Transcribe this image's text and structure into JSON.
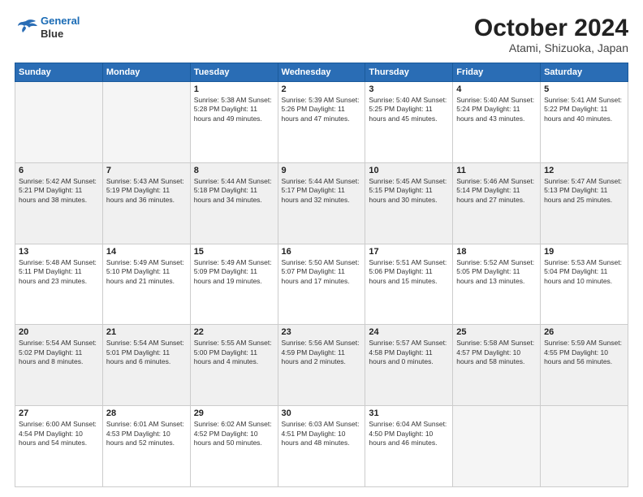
{
  "header": {
    "logo_line1": "General",
    "logo_line2": "Blue",
    "title": "October 2024",
    "subtitle": "Atami, Shizuoka, Japan"
  },
  "weekdays": [
    "Sunday",
    "Monday",
    "Tuesday",
    "Wednesday",
    "Thursday",
    "Friday",
    "Saturday"
  ],
  "weeks": [
    [
      {
        "day": "",
        "info": ""
      },
      {
        "day": "",
        "info": ""
      },
      {
        "day": "1",
        "info": "Sunrise: 5:38 AM\nSunset: 5:28 PM\nDaylight: 11 hours and 49 minutes."
      },
      {
        "day": "2",
        "info": "Sunrise: 5:39 AM\nSunset: 5:26 PM\nDaylight: 11 hours and 47 minutes."
      },
      {
        "day": "3",
        "info": "Sunrise: 5:40 AM\nSunset: 5:25 PM\nDaylight: 11 hours and 45 minutes."
      },
      {
        "day": "4",
        "info": "Sunrise: 5:40 AM\nSunset: 5:24 PM\nDaylight: 11 hours and 43 minutes."
      },
      {
        "day": "5",
        "info": "Sunrise: 5:41 AM\nSunset: 5:22 PM\nDaylight: 11 hours and 40 minutes."
      }
    ],
    [
      {
        "day": "6",
        "info": "Sunrise: 5:42 AM\nSunset: 5:21 PM\nDaylight: 11 hours and 38 minutes."
      },
      {
        "day": "7",
        "info": "Sunrise: 5:43 AM\nSunset: 5:19 PM\nDaylight: 11 hours and 36 minutes."
      },
      {
        "day": "8",
        "info": "Sunrise: 5:44 AM\nSunset: 5:18 PM\nDaylight: 11 hours and 34 minutes."
      },
      {
        "day": "9",
        "info": "Sunrise: 5:44 AM\nSunset: 5:17 PM\nDaylight: 11 hours and 32 minutes."
      },
      {
        "day": "10",
        "info": "Sunrise: 5:45 AM\nSunset: 5:15 PM\nDaylight: 11 hours and 30 minutes."
      },
      {
        "day": "11",
        "info": "Sunrise: 5:46 AM\nSunset: 5:14 PM\nDaylight: 11 hours and 27 minutes."
      },
      {
        "day": "12",
        "info": "Sunrise: 5:47 AM\nSunset: 5:13 PM\nDaylight: 11 hours and 25 minutes."
      }
    ],
    [
      {
        "day": "13",
        "info": "Sunrise: 5:48 AM\nSunset: 5:11 PM\nDaylight: 11 hours and 23 minutes."
      },
      {
        "day": "14",
        "info": "Sunrise: 5:49 AM\nSunset: 5:10 PM\nDaylight: 11 hours and 21 minutes."
      },
      {
        "day": "15",
        "info": "Sunrise: 5:49 AM\nSunset: 5:09 PM\nDaylight: 11 hours and 19 minutes."
      },
      {
        "day": "16",
        "info": "Sunrise: 5:50 AM\nSunset: 5:07 PM\nDaylight: 11 hours and 17 minutes."
      },
      {
        "day": "17",
        "info": "Sunrise: 5:51 AM\nSunset: 5:06 PM\nDaylight: 11 hours and 15 minutes."
      },
      {
        "day": "18",
        "info": "Sunrise: 5:52 AM\nSunset: 5:05 PM\nDaylight: 11 hours and 13 minutes."
      },
      {
        "day": "19",
        "info": "Sunrise: 5:53 AM\nSunset: 5:04 PM\nDaylight: 11 hours and 10 minutes."
      }
    ],
    [
      {
        "day": "20",
        "info": "Sunrise: 5:54 AM\nSunset: 5:02 PM\nDaylight: 11 hours and 8 minutes."
      },
      {
        "day": "21",
        "info": "Sunrise: 5:54 AM\nSunset: 5:01 PM\nDaylight: 11 hours and 6 minutes."
      },
      {
        "day": "22",
        "info": "Sunrise: 5:55 AM\nSunset: 5:00 PM\nDaylight: 11 hours and 4 minutes."
      },
      {
        "day": "23",
        "info": "Sunrise: 5:56 AM\nSunset: 4:59 PM\nDaylight: 11 hours and 2 minutes."
      },
      {
        "day": "24",
        "info": "Sunrise: 5:57 AM\nSunset: 4:58 PM\nDaylight: 11 hours and 0 minutes."
      },
      {
        "day": "25",
        "info": "Sunrise: 5:58 AM\nSunset: 4:57 PM\nDaylight: 10 hours and 58 minutes."
      },
      {
        "day": "26",
        "info": "Sunrise: 5:59 AM\nSunset: 4:55 PM\nDaylight: 10 hours and 56 minutes."
      }
    ],
    [
      {
        "day": "27",
        "info": "Sunrise: 6:00 AM\nSunset: 4:54 PM\nDaylight: 10 hours and 54 minutes."
      },
      {
        "day": "28",
        "info": "Sunrise: 6:01 AM\nSunset: 4:53 PM\nDaylight: 10 hours and 52 minutes."
      },
      {
        "day": "29",
        "info": "Sunrise: 6:02 AM\nSunset: 4:52 PM\nDaylight: 10 hours and 50 minutes."
      },
      {
        "day": "30",
        "info": "Sunrise: 6:03 AM\nSunset: 4:51 PM\nDaylight: 10 hours and 48 minutes."
      },
      {
        "day": "31",
        "info": "Sunrise: 6:04 AM\nSunset: 4:50 PM\nDaylight: 10 hours and 46 minutes."
      },
      {
        "day": "",
        "info": ""
      },
      {
        "day": "",
        "info": ""
      }
    ]
  ]
}
